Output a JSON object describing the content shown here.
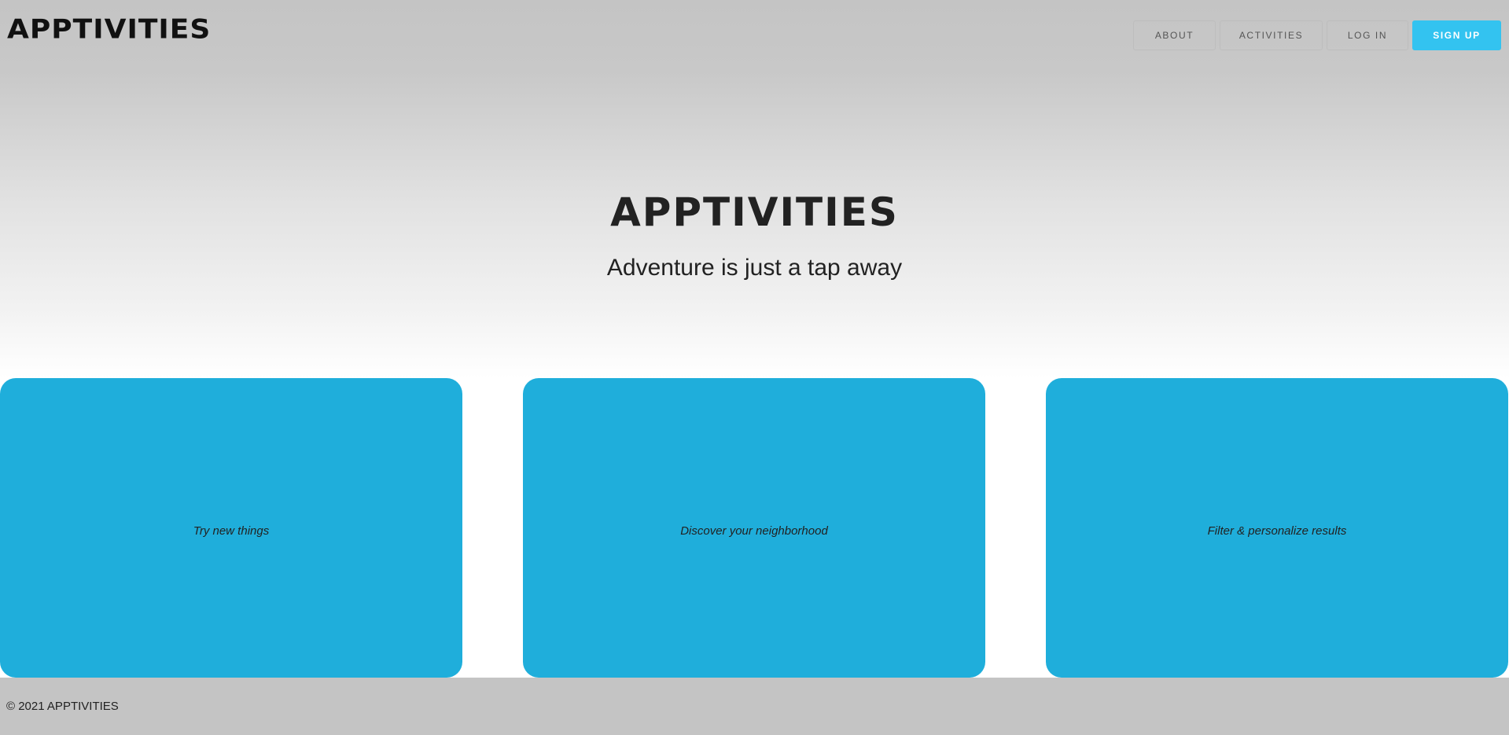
{
  "header": {
    "brand": "APPTIVITIES",
    "nav": {
      "about": "ABOUT",
      "activities": "ACTIVITIES",
      "login": "LOG IN",
      "signup": "SIGN UP"
    }
  },
  "hero": {
    "title": "APPTIVITIES",
    "subtitle": "Adventure is just a tap away"
  },
  "cards": [
    {
      "text": "Try new things"
    },
    {
      "text": "Discover your neighborhood"
    },
    {
      "text": "Filter & personalize results"
    }
  ],
  "footer": {
    "copyright": "© 2021 APPTIVITIES"
  },
  "colors": {
    "accent": "#33c3f0",
    "card": "#1faedb",
    "header_bg": "#c4c4c4",
    "text": "#222222"
  }
}
